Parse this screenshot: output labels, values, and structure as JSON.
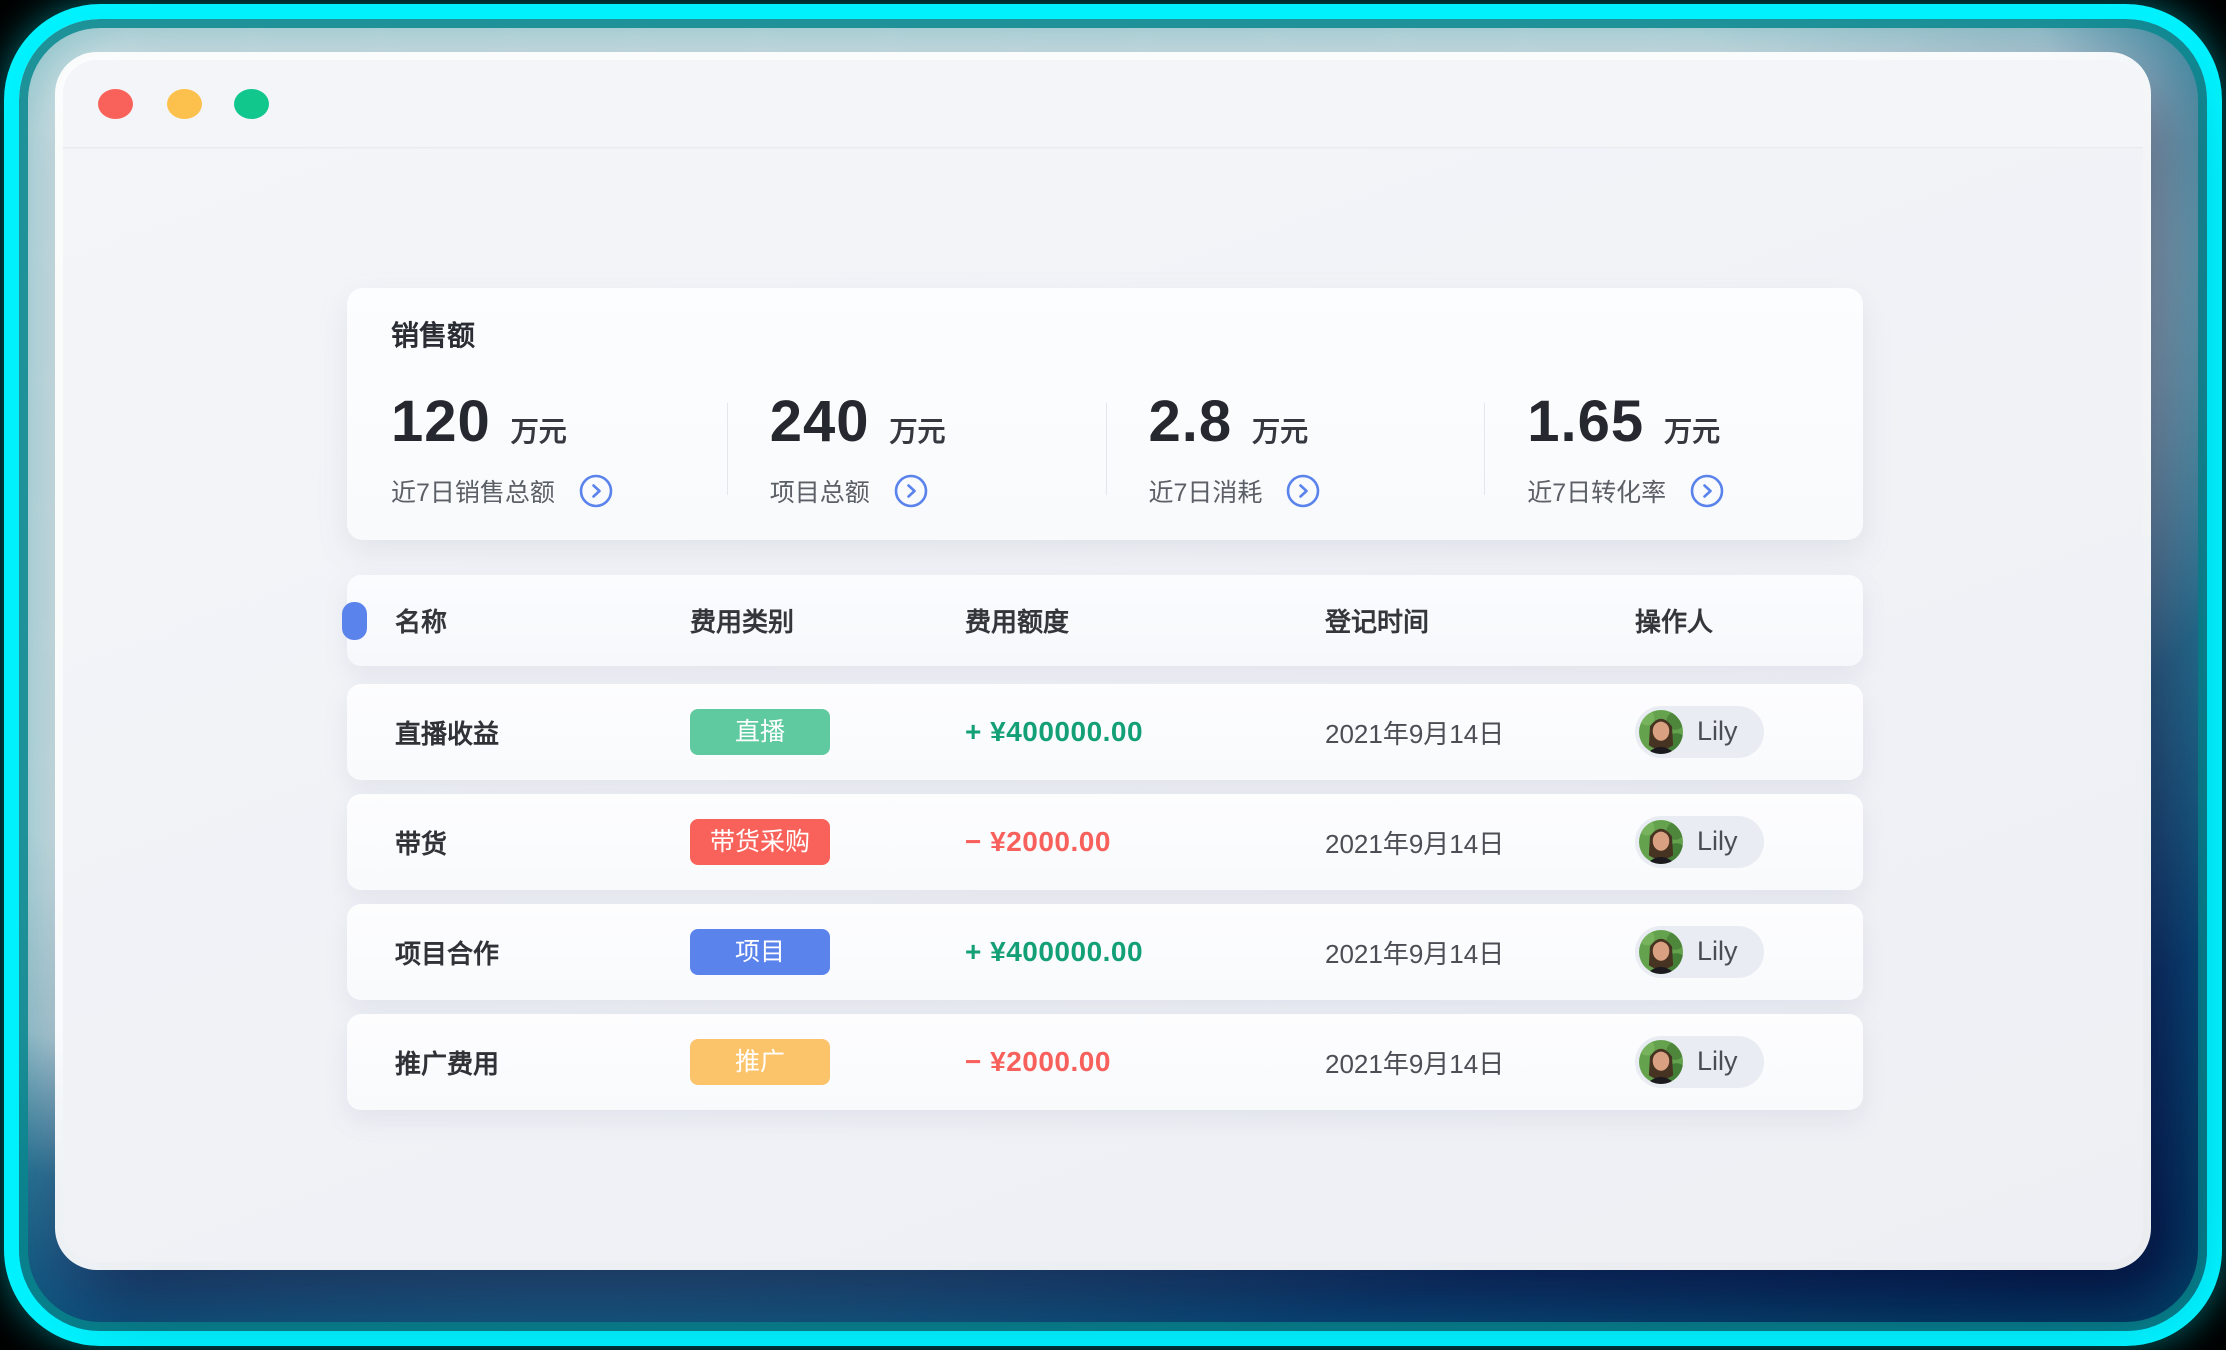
{
  "window": {
    "controls": [
      "close",
      "minimize",
      "zoom"
    ]
  },
  "stats_card": {
    "title": "销售额",
    "stats": [
      {
        "value": "120",
        "unit": "万元",
        "label": "近7日销售总额"
      },
      {
        "value": "240",
        "unit": "万元",
        "label": "项目总额"
      },
      {
        "value": "2.8",
        "unit": "万元",
        "label": "近7日消耗"
      },
      {
        "value": "1.65",
        "unit": "万元",
        "label": "近7日转化率"
      }
    ]
  },
  "table": {
    "columns": [
      "名称",
      "费用类别",
      "费用额度",
      "登记时间",
      "操作人"
    ],
    "rows": [
      {
        "name": "直播收益",
        "category": "直播",
        "category_color": "#5fcaa0",
        "amount": "+ ¥400000.00",
        "amount_color": "#14a077",
        "date": "2021年9月14日",
        "operator": "Lily"
      },
      {
        "name": "带货",
        "category": "带货采购",
        "category_color": "#f9625a",
        "amount": "− ¥2000.00",
        "amount_color": "#f8605c",
        "date": "2021年9月14日",
        "operator": "Lily"
      },
      {
        "name": "项目合作",
        "category": "项目",
        "category_color": "#5b83ec",
        "amount": "+ ¥400000.00",
        "amount_color": "#14a077",
        "date": "2021年9月14日",
        "operator": "Lily"
      },
      {
        "name": "推广费用",
        "category": "推广",
        "category_color": "#fbc46b",
        "amount": "− ¥2000.00",
        "amount_color": "#f8605c",
        "date": "2021年9月14日",
        "operator": "Lily"
      }
    ]
  },
  "colors": {
    "accent_blue": "#5b83ec",
    "positive_green": "#14a077",
    "negative_red": "#f8605c",
    "badge_green": "#5fcaa0",
    "badge_red": "#f9625a",
    "badge_blue": "#5b83ec",
    "badge_yellow": "#fbc46b",
    "traffic_red": "#f9625a",
    "traffic_yellow": "#fcc14d",
    "traffic_green": "#12c78c",
    "neon_cyan": "#00f2ff"
  }
}
